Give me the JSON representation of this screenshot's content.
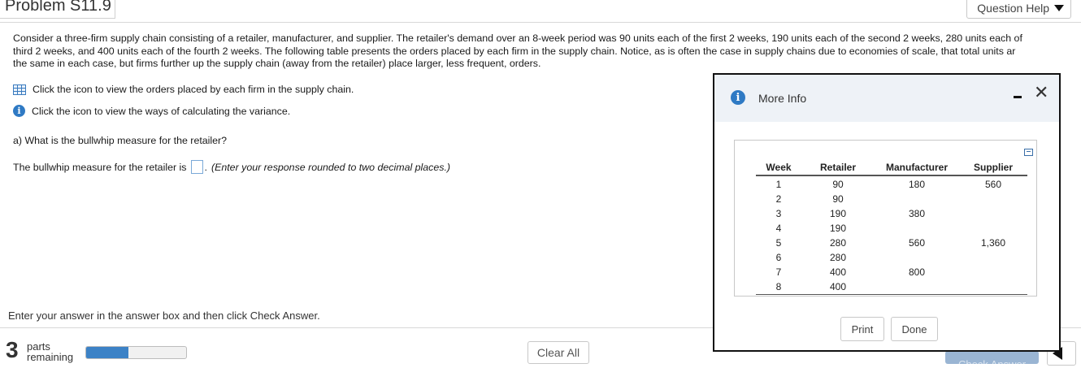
{
  "header": {
    "title": "Problem S11.9",
    "help_label": "Question Help"
  },
  "problem": {
    "lines": [
      "Consider a three-firm supply chain consisting of a retailer, manufacturer, and supplier. The retailer's demand over an 8-week period was 90 units each of the first 2 weeks, 190 units each of the second 2 weeks, 280 units each of",
      "third 2 weeks, and 400 units each of the fourth 2 weeks. The following table presents the orders placed by each firm in the supply chain. Notice, as is often the case in supply chains due to economies of scale, that total units ar",
      "the same in each case, but firms further up the supply chain (away from the retailer) place larger, less frequent, orders."
    ],
    "table_link": "Click the icon to view the orders placed by each firm in the supply chain.",
    "info_link": "Click the icon to view the ways of calculating the variance.",
    "question": "a) What is the bullwhip measure for the retailer?",
    "answer_prefix": "The bullwhip measure for the retailer is",
    "answer_suffix": ".",
    "answer_hint": "(Enter your response rounded to two decimal places.)"
  },
  "footer": {
    "instruction": "Enter your answer in the answer box and then click Check Answer.",
    "parts_count": "3",
    "parts_label_1": "parts",
    "parts_label_2": "remaining",
    "progress_fraction": 0.42,
    "clear_label": "Clear All",
    "check_label": "Check Answer"
  },
  "modal": {
    "title": "More Info",
    "columns": [
      "Week",
      "Retailer",
      "Manufacturer",
      "Supplier"
    ],
    "rows": [
      [
        "1",
        "90",
        "180",
        "560"
      ],
      [
        "2",
        "90",
        "",
        ""
      ],
      [
        "3",
        "190",
        "380",
        ""
      ],
      [
        "4",
        "190",
        "",
        ""
      ],
      [
        "5",
        "280",
        "560",
        "1,360"
      ],
      [
        "6",
        "280",
        "",
        ""
      ],
      [
        "7",
        "400",
        "800",
        ""
      ],
      [
        "8",
        "400",
        "",
        ""
      ]
    ],
    "print_label": "Print",
    "done_label": "Done"
  },
  "icons": {
    "table": "table-icon",
    "info": "info-icon",
    "minimize": "minimize-icon",
    "close": "close-icon",
    "copy": "copy-icon",
    "caret": "caret-down-icon",
    "back": "back-arrow-icon"
  },
  "colors": {
    "accent": "#3c82c6",
    "info": "#2f7ac4"
  }
}
